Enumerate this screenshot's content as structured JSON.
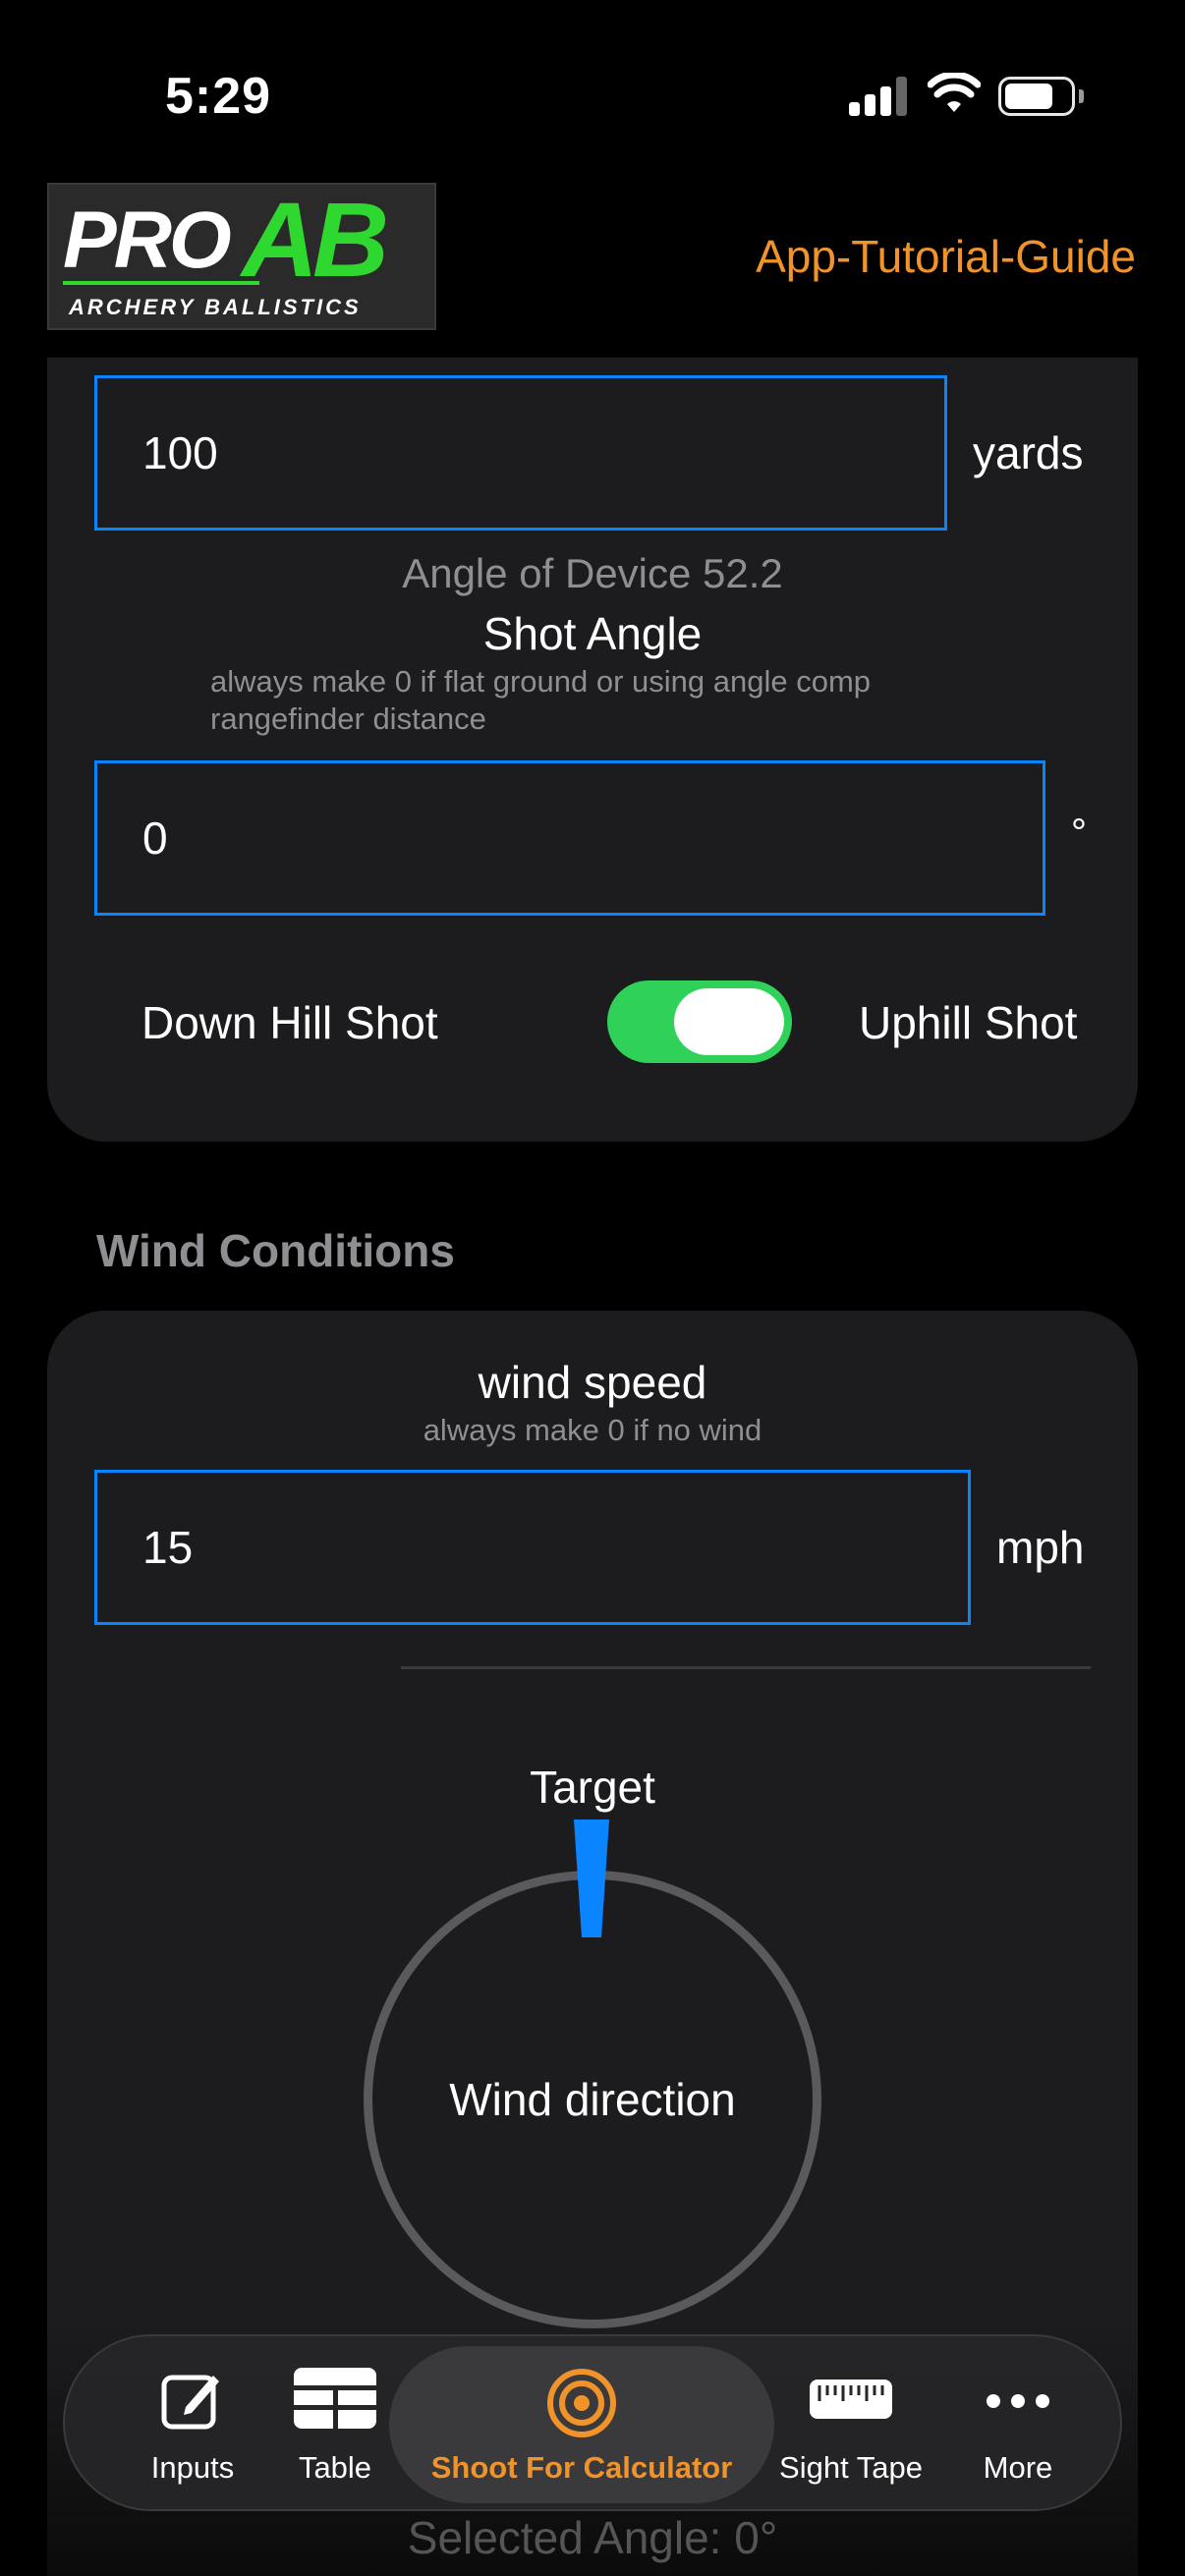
{
  "status_bar": {
    "time": "5:29"
  },
  "header": {
    "logo_text_pro": "PRO",
    "logo_text_ab": "AB",
    "logo_subtitle": "ARCHERY BALLISTICS",
    "tutorial_link": "App-Tutorial-Guide"
  },
  "distance": {
    "value": "100",
    "unit": "yards"
  },
  "angle_of_device": "Angle of Device 52.2",
  "shot_angle": {
    "title": "Shot Angle",
    "hint_line1": "always make 0 if flat ground or using angle comp",
    "hint_line2": "rangefinder distance",
    "value": "0",
    "unit": "°"
  },
  "hill_toggle": {
    "left_label": "Down Hill Shot",
    "right_label": "Uphill Shot",
    "on": true
  },
  "wind": {
    "section_title": "Wind Conditions",
    "speed_title": "wind speed",
    "speed_hint": "always make 0 if no wind",
    "speed_value": "15",
    "speed_unit": "mph",
    "target_label": "Target",
    "dial_label": "Wind direction"
  },
  "selected_angle": "Selected Angle: 0°",
  "tabs": [
    {
      "label": "Inputs",
      "icon": "edit-icon"
    },
    {
      "label": "Table",
      "icon": "table-icon"
    },
    {
      "label": "Shoot For Calculator",
      "icon": "target-icon",
      "active": true
    },
    {
      "label": "Sight Tape",
      "icon": "ruler-icon"
    },
    {
      "label": "More",
      "icon": "more-icon"
    }
  ],
  "colors": {
    "accent": "#f0932b",
    "input_border": "#0a84ff",
    "toggle_on": "#30d158",
    "logo_green": "#2fd82f"
  }
}
